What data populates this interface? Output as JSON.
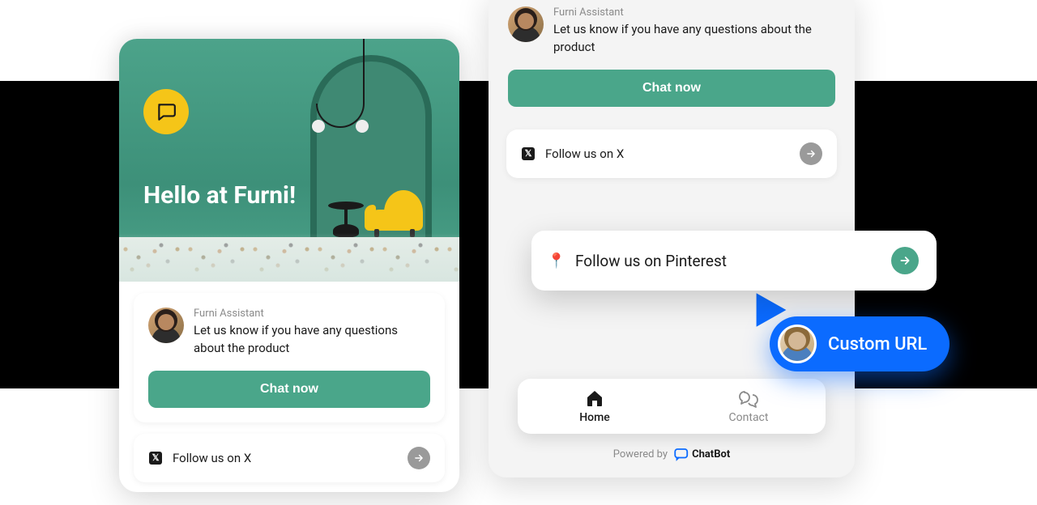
{
  "hero": {
    "title": "Hello at Furni!"
  },
  "assistant": {
    "name": "Furni Assistant",
    "message": "Let us know if you have any questions about the product",
    "chat_button": "Chat now"
  },
  "links": {
    "x": {
      "label": "Follow us on X"
    },
    "pinterest": {
      "label": "Follow us on Pinterest"
    }
  },
  "nav": {
    "home": "Home",
    "contact": "Contact"
  },
  "footer": {
    "powered_by": "Powered by",
    "brand": "ChatBot"
  },
  "callout": {
    "label": "Custom URL"
  },
  "colors": {
    "accent_green": "#4aa68a",
    "accent_yellow": "#f5c518",
    "accent_blue": "#0b6bff"
  }
}
